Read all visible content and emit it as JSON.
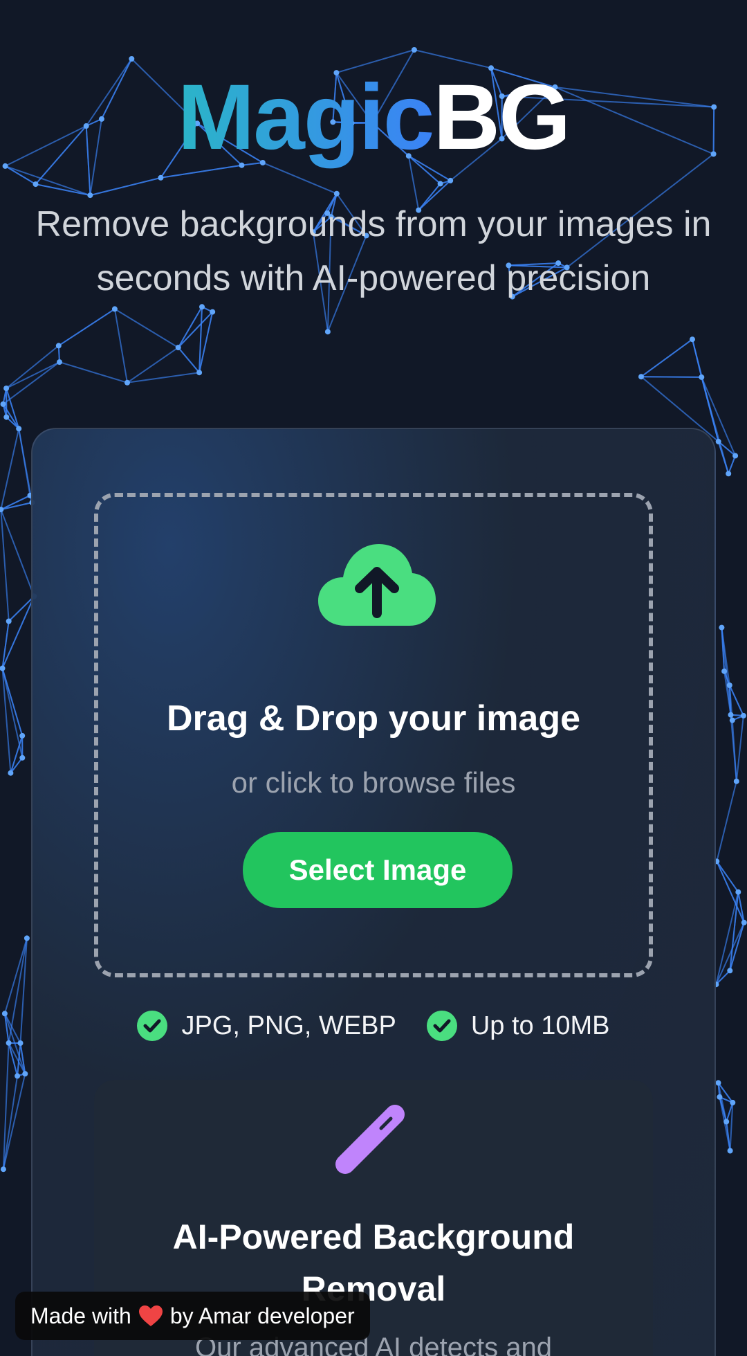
{
  "brand": {
    "part1": "Magic",
    "part2": "BG"
  },
  "tagline": "Remove backgrounds from your images in seconds with AI-powered precision",
  "upload": {
    "icon": "cloud-upload-icon",
    "title": "Drag & Drop your image",
    "subtitle": "or click to browse files",
    "button_label": "Select Image"
  },
  "badges": [
    {
      "icon": "check-circle-icon",
      "label": "JPG, PNG, WEBP"
    },
    {
      "icon": "check-circle-icon",
      "label": "Up to 10MB"
    }
  ],
  "feature": {
    "icon": "magic-wand-icon",
    "title": "AI-Powered Background Removal",
    "description": "Our advanced AI detects and"
  },
  "footer_badge": {
    "prefix": "Made with",
    "icon": "heart-icon",
    "suffix": "by Amar developer"
  },
  "colors": {
    "background": "#111827",
    "network_lines": "#3b82f6",
    "accent_green": "#22c55e",
    "wand_purple": "#c084fc",
    "brand_gradient_start": "#2bb5c8",
    "brand_gradient_end": "#3b82f6"
  }
}
